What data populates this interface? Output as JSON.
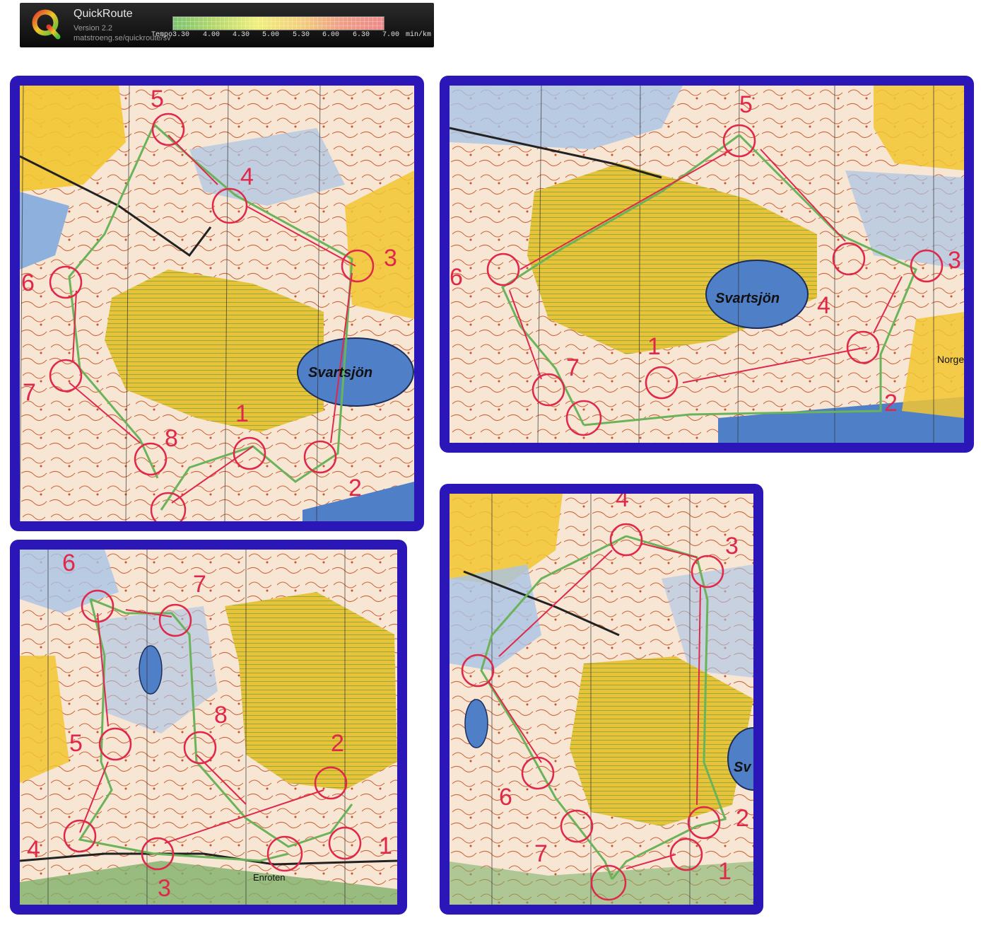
{
  "header": {
    "app_name": "QuickRoute",
    "version": "Version 2.2",
    "url": "matstroeng.se/quickroute/sv",
    "legend_title": "Tempo",
    "legend_ticks": [
      "3.30",
      "4.00",
      "4.30",
      "5.00",
      "5.30",
      "6.00",
      "6.30",
      "7.00"
    ],
    "legend_unit": "min/km",
    "legend_colors": [
      "#7cc36f",
      "#b6d86d",
      "#f0ef7a",
      "#f2d07d",
      "#ef9f86",
      "#ee8a8a"
    ]
  },
  "colors": {
    "frame": "#2b16b8",
    "control_red": "#e0284a",
    "route_green": "#6bb35a",
    "water": "#5a86c8",
    "yellow_field": "#f2c530",
    "contour_brown": "#c8502a"
  },
  "maps": [
    {
      "name": "map-top-left",
      "control_labels": [
        "5",
        "4",
        "3",
        "6",
        "7",
        "8",
        "1",
        "2"
      ],
      "lake_label": "Svartsjön"
    },
    {
      "name": "map-top-right",
      "control_labels": [
        "5",
        "3",
        "6",
        "4",
        "1",
        "7",
        "2"
      ],
      "lake_label": "Svartsjön",
      "place_label": "Norge"
    },
    {
      "name": "map-bottom-left",
      "control_labels": [
        "6",
        "7",
        "8",
        "5",
        "2",
        "4",
        "3",
        "1"
      ],
      "place_label": "Enroten"
    },
    {
      "name": "map-bottom-right",
      "control_labels": [
        "4",
        "3",
        "6",
        "2",
        "7",
        "1"
      ],
      "lake_label": "Sv"
    }
  ]
}
